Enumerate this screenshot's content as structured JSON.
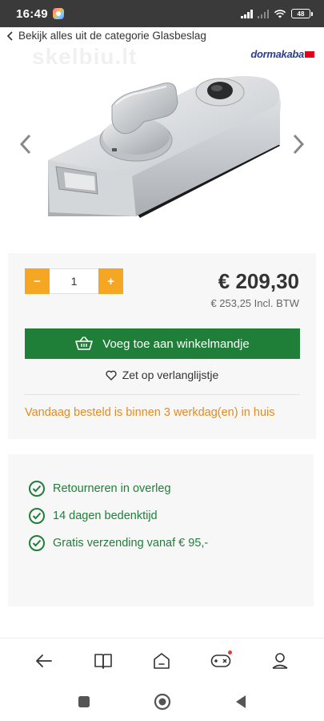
{
  "status_bar": {
    "time": "16:49",
    "battery": "48"
  },
  "breadcrumb": {
    "label": "Bekijk alles uit de categorie Glasbeslag"
  },
  "brand": {
    "name": "dormakaba"
  },
  "watermark": {
    "text": "skelbiu.lt"
  },
  "product": {
    "quantity": "1",
    "decrement_label": "−",
    "increment_label": "+",
    "price": "€ 209,30",
    "price_incl": "€ 253,25 Incl. BTW",
    "add_to_cart_label": "Voeg toe aan winkelmandje",
    "wishlist_label": "Zet op verlanglijstje",
    "delivery_text": "Vandaag besteld is binnen 3 werkdag(en) in huis"
  },
  "usps": [
    "Retourneren in overleg",
    "14 dagen bedenktijd",
    "Gratis verzending vanaf € 95,-"
  ],
  "colors": {
    "accent_orange": "#f5a623",
    "cart_green": "#1f7f38",
    "delivery_orange": "#e88a1a",
    "brand_blue": "#2c3e8f",
    "brand_red": "#e2001a"
  },
  "bottom_nav": {
    "icons": [
      "back-arrow-icon",
      "book-icon",
      "home-icon",
      "gamepad-icon",
      "profile-icon"
    ]
  },
  "system_nav": {
    "icons": [
      "recents-square-icon",
      "home-circle-icon",
      "back-triangle-icon"
    ]
  }
}
